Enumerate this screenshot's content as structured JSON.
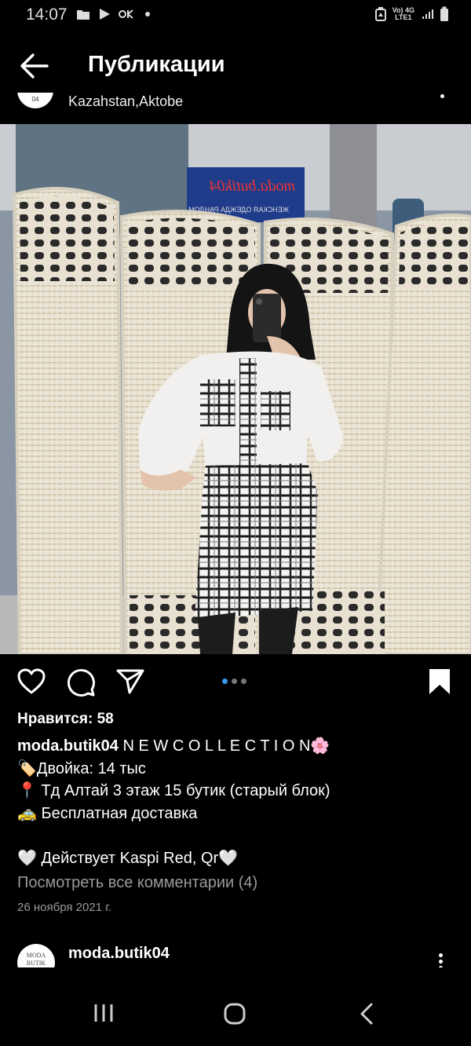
{
  "status": {
    "time": "14:07",
    "network_top": "Vo) 4G",
    "network_bottom": "LTE1"
  },
  "header": {
    "title": "Публикации"
  },
  "previous_post": {
    "location": "Kazahstan,Aktobe",
    "avatar_text": "04"
  },
  "post": {
    "photo": {
      "store_sign": "moda.butik04",
      "store_sign_sub": "ЖЕНСКАЯ ОДЕЖДА РАНДОМ"
    },
    "pager": {
      "count": 3,
      "active": 0,
      "active_color": "#3797f0"
    },
    "likes": "Нравится: 58",
    "username": "moda.butik04",
    "caption_first": "N E W  C O L L E C T I O N🌸",
    "caption_lines": [
      "🏷️Двойка: 14 тыс",
      "📍 Тд Алтай 3 этаж 15 бутик (старый блок)",
      "🚕 Бесплатная доставка",
      "",
      "🤍 Действует Kaspi Red, Qr🤍"
    ],
    "view_comments": "Посмотреть все комментарии (4)",
    "date": "26 ноября 2021 г."
  },
  "next_post": {
    "username": "moda.butik04",
    "avatar_line1": "MODA",
    "avatar_line2": "BUTIK"
  },
  "icons": {
    "back": "arrow-left-icon",
    "like": "heart-icon",
    "comment": "comment-icon",
    "share": "send-icon",
    "save": "bookmark-icon",
    "more": "more-vertical-icon"
  }
}
